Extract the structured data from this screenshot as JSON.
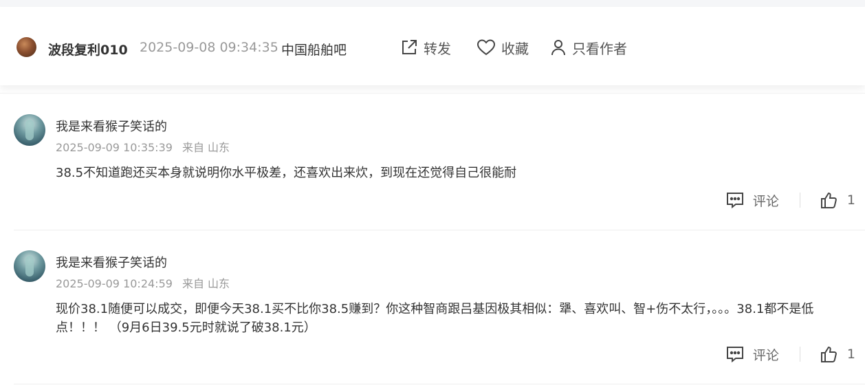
{
  "post": {
    "author": "波段复利010",
    "time": "2025-09-08 09:34:35",
    "forum": "中国船舶吧",
    "actions": {
      "share": "转发",
      "favorite": "收藏",
      "only_author": "只看作者"
    }
  },
  "comments": [
    {
      "user": "我是来看猴子笑话的",
      "time": "2025-09-09 10:35:39",
      "location": "来自 山东",
      "content": "38.5不知道跑还买本身就说明你水平极差，还喜欢出来炊，到现在还觉得自己很能耐",
      "reply_label": "评论",
      "likes": "1"
    },
    {
      "user": "我是来看猴子笑话的",
      "time": "2025-09-09 10:24:59",
      "location": "来自 山东",
      "content": "现价38.1随便可以成交，即便今天38.1买不比你38.5赚到？你这种智商跟吕基因极其相似：犟、喜欢叫、智+伤不太行，。。。38.1都不是低点！！！ （9月6日39.5元时就说了破38.1元）",
      "reply_label": "评论",
      "likes": "1"
    }
  ],
  "icons": {
    "share": "share-icon",
    "favorite": "heart-icon",
    "only_author": "user-icon",
    "reply": "comment-icon",
    "like": "thumbs-up-icon"
  }
}
